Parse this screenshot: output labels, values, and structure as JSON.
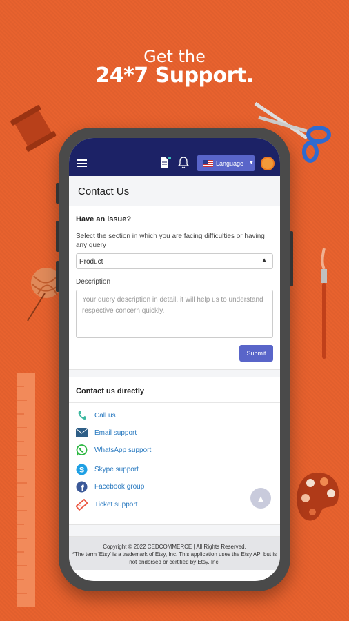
{
  "promo": {
    "line1": "Get the",
    "line2": "24*7 Support."
  },
  "header": {
    "menu_icon": "hamburger-icon",
    "doc_icon": "document-icon",
    "bell_icon": "bell-icon",
    "language_label": "Language",
    "accent": "#1c2266",
    "button_color": "#5965c9"
  },
  "page": {
    "title": "Contact Us"
  },
  "form": {
    "heading": "Have an issue?",
    "select_label": "Select the section in which you are facing difficulties or having any query",
    "select_value": "Product",
    "description_label": "Description",
    "description_placeholder": "Your query description in detail, it will help us to understand respective concern quickly.",
    "submit_label": "Submit"
  },
  "contact": {
    "heading": "Contact us directly",
    "items": [
      {
        "label": "Call us",
        "icon": "phone-icon"
      },
      {
        "label": "Email support",
        "icon": "email-icon"
      },
      {
        "label": "WhatsApp support",
        "icon": "whatsapp-icon"
      },
      {
        "label": "Skype support",
        "icon": "skype-icon"
      },
      {
        "label": "Facebook group",
        "icon": "facebook-icon"
      },
      {
        "label": "Ticket support",
        "icon": "ticket-icon"
      }
    ]
  },
  "footer": {
    "copyright": "Copyright © 2022 CEDCOMMERCE | All Rights Reserved.",
    "disclaimer": "*The term 'Etsy' is a trademark of Etsy, Inc. This application uses the Etsy API but is not endorsed or certified by Etsy, Inc."
  }
}
